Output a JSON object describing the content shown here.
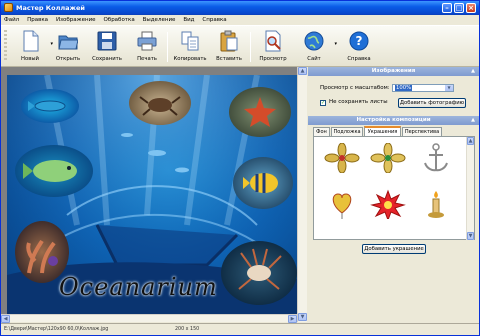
{
  "window": {
    "title": "Мастер Коллажей"
  },
  "menu": [
    "Файл",
    "Правка",
    "Изображение",
    "Обработка",
    "Выделение",
    "Вид",
    "Справка"
  ],
  "toolbar": [
    {
      "label": "Новый",
      "icon": "new-document-icon"
    },
    {
      "label": "Открыть",
      "icon": "open-folder-icon"
    },
    {
      "label": "Сохранить",
      "icon": "save-disk-icon"
    },
    {
      "label": "Печать",
      "icon": "printer-icon"
    },
    {
      "label": "Копировать",
      "icon": "copy-icon"
    },
    {
      "label": "Вставить",
      "icon": "paste-clipboard-icon"
    },
    {
      "label": "Просмотр",
      "icon": "preview-magnifier-icon"
    },
    {
      "label": "Сайт",
      "icon": "website-globe-icon"
    },
    {
      "label": "Справка",
      "icon": "help-icon"
    }
  ],
  "canvas": {
    "title_text": "Oceanarium"
  },
  "status": {
    "left": "Е:\\Двери\\Мастер\\120x90 60,0\\Коллаж.jpg",
    "right": "200 x 150"
  },
  "images_panel": {
    "header": "Изображения",
    "preview_label": "Просмотр с масштабом:",
    "zoom_value": "100%",
    "keep_label": "Не сохранять листы",
    "keep_checked": true,
    "add_photo_button": "Добавить фотографию"
  },
  "composition_panel": {
    "header": "Настройка композиции",
    "tabs": [
      "Фон",
      "Подложка",
      "Украшения",
      "Перспектива"
    ],
    "active_tab": 2,
    "items": [
      "gold-flower-ornament",
      "gold-flower-ornament-2",
      "anchor-ornament",
      "heart-balloon-ornament",
      "red-star-burst-ornament",
      "candle-ornament"
    ],
    "add_ornament_button": "Добавить украшение"
  },
  "colors": {
    "accent": "#0a5ce8",
    "panel_header": "#7f9bd0",
    "ocean": "#0e63b4"
  }
}
